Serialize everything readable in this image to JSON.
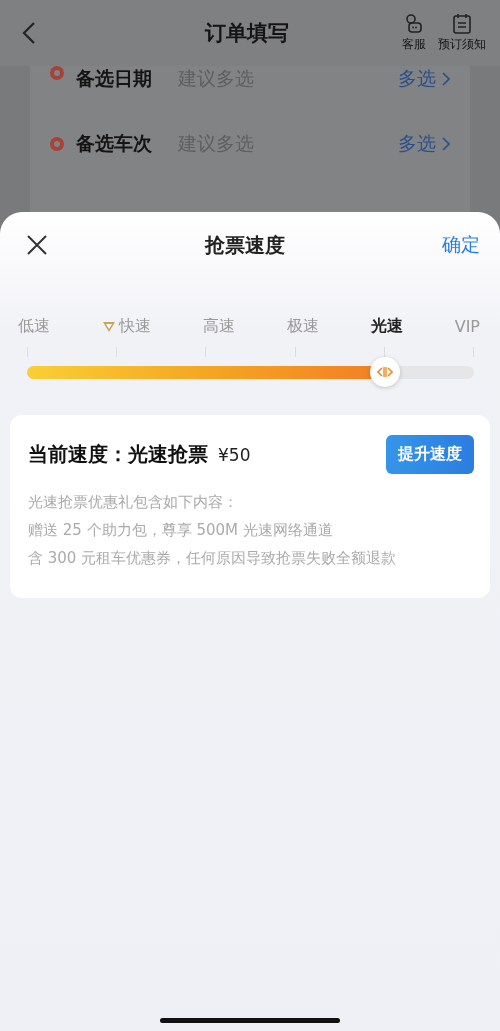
{
  "header": {
    "title": "订单填写",
    "actions": [
      {
        "label": "客服",
        "kind": "service"
      },
      {
        "label": "预订须知",
        "kind": "notice"
      }
    ]
  },
  "rows": [
    {
      "label": "备选日期",
      "hint": "建议多选",
      "action": "多选",
      "color": "#a84238"
    },
    {
      "label": "备选车次",
      "hint": "建议多选",
      "action": "多选",
      "color": "#a84238"
    }
  ],
  "sheet": {
    "title": "抢票速度",
    "confirm": "确定",
    "speeds": [
      {
        "label": "低速",
        "kind": "plain",
        "selected": false
      },
      {
        "label": "快速",
        "kind": "badge",
        "selected": false
      },
      {
        "label": "高速",
        "kind": "plain",
        "selected": false
      },
      {
        "label": "极速",
        "kind": "plain",
        "selected": false
      },
      {
        "label": "光速",
        "kind": "plain",
        "selected": true
      },
      {
        "label": "VIP",
        "kind": "plain",
        "selected": false
      }
    ],
    "slider": {
      "level": 0.8
    },
    "card": {
      "title": "当前速度：光速抢票",
      "price": "¥50",
      "button": "提升速度",
      "bullets": [
        "光速抢票优惠礼包含如下内容：",
        "赠送 25 个助力包，尊享 500M 光速网络通道",
        "含 300 元租车优惠券，任何原因导致抢票失败全额退款"
      ]
    }
  }
}
